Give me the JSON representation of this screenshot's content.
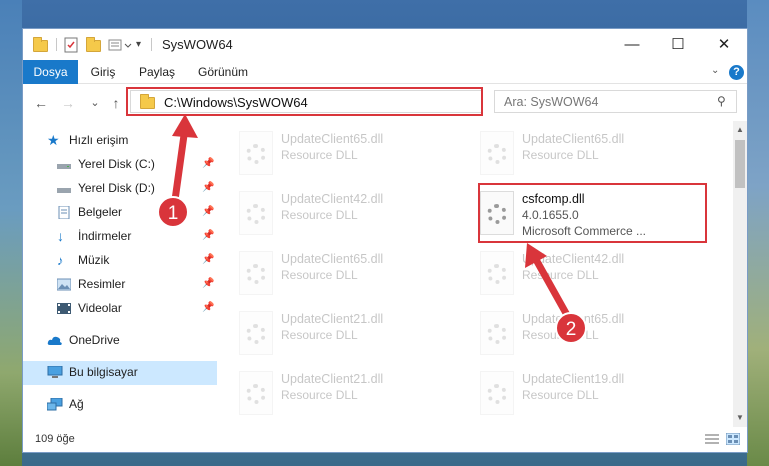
{
  "window": {
    "title": "SysWOW64"
  },
  "ribbon": {
    "tabs": [
      "Dosya",
      "Giriş",
      "Paylaş",
      "Görünüm"
    ],
    "active_tab": "Dosya",
    "help_glyph": "?"
  },
  "controls": {
    "minimize": "—",
    "maximize": "☐",
    "close": "✕"
  },
  "navbar": {
    "back": "←",
    "forward": "→",
    "recent": "⌄",
    "up": "↑",
    "address": "C:\\Windows\\SysWOW64",
    "search_placeholder": "Ara: SysWOW64"
  },
  "nav_pane": {
    "quick_access": "Hızlı erişim",
    "items": [
      {
        "label": "Yerel Disk (C:)",
        "icon": "drive-icon",
        "pinned": true
      },
      {
        "label": "Yerel Disk (D:)",
        "icon": "drive-icon",
        "pinned": true
      },
      {
        "label": "Belgeler",
        "icon": "documents-icon",
        "pinned": true
      },
      {
        "label": "İndirmeler",
        "icon": "download-icon",
        "pinned": true
      },
      {
        "label": "Müzik",
        "icon": "music-icon",
        "pinned": true
      },
      {
        "label": "Resimler",
        "icon": "pictures-icon",
        "pinned": true
      },
      {
        "label": "Videolar",
        "icon": "videos-icon",
        "pinned": true
      }
    ],
    "onedrive": "OneDrive",
    "this_pc": "Bu bilgisayar",
    "network": "Ağ"
  },
  "files": {
    "left_column": [
      {
        "name": "UpdateClient65.dll",
        "desc": "Resource DLL"
      },
      {
        "name": "UpdateClient42.dll",
        "desc": "Resource DLL"
      },
      {
        "name": "UpdateClient65.dll",
        "desc": "Resource DLL"
      },
      {
        "name": "UpdateClient21.dll",
        "desc": "Resource DLL"
      },
      {
        "name": "UpdateClient21.dll",
        "desc": "Resource DLL"
      }
    ],
    "right_column": [
      {
        "name": "UpdateClient65.dll",
        "desc": "Resource DLL"
      },
      {
        "name": "csfcomp.dll",
        "desc": "4.0.1655.0",
        "desc2": "Microsoft Commerce ...",
        "highlighted": true
      },
      {
        "name": "UpdateClient42.dll",
        "desc": "Resource DLL"
      },
      {
        "name": "UpdateClient65.dll",
        "desc": "Resource DLL"
      },
      {
        "name": "UpdateClient19.dll",
        "desc": "Resource DLL"
      }
    ]
  },
  "status": {
    "item_count": "109 öğe"
  },
  "annotations": {
    "step1": "1",
    "step2": "2",
    "color": "#d9353b"
  }
}
